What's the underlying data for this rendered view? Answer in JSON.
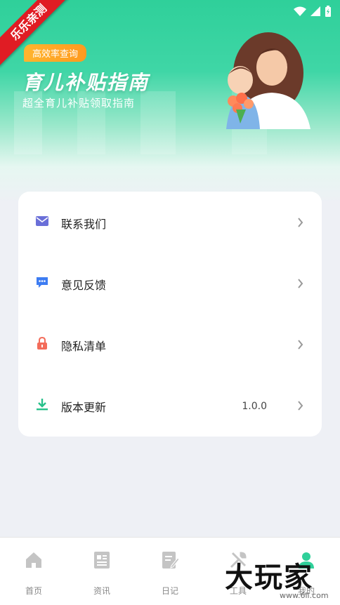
{
  "ribbon": {
    "label": "乐乐亲测"
  },
  "hero": {
    "badge": "高效率查询",
    "title": "育儿补贴指南",
    "subtitle": "超全育儿补贴领取指南"
  },
  "menu": {
    "items": [
      {
        "label": "联系我们",
        "icon": "mail-icon",
        "color": "#6a6fd8",
        "value": ""
      },
      {
        "label": "意见反馈",
        "icon": "feedback-chat-icon",
        "color": "#3d7cf2",
        "value": ""
      },
      {
        "label": "隐私清单",
        "icon": "lock-icon",
        "color": "#f36c5a",
        "value": ""
      },
      {
        "label": "版本更新",
        "icon": "download-icon",
        "color": "#27c08a",
        "value": "1.0.0"
      }
    ]
  },
  "tabbar": {
    "tabs": [
      {
        "label": "首页",
        "icon": "home-icon"
      },
      {
        "label": "资讯",
        "icon": "news-icon"
      },
      {
        "label": "日记",
        "icon": "diary-icon"
      },
      {
        "label": "工具",
        "icon": "tools-icon"
      },
      {
        "label": "我的",
        "icon": "profile-icon",
        "active": true
      }
    ]
  },
  "watermark": {
    "main": "大玩家",
    "sub": "www.6ll.com"
  },
  "colors": {
    "accent": "#2fd09a",
    "badge": "#ffa726",
    "ribbon": "#e01c24"
  }
}
